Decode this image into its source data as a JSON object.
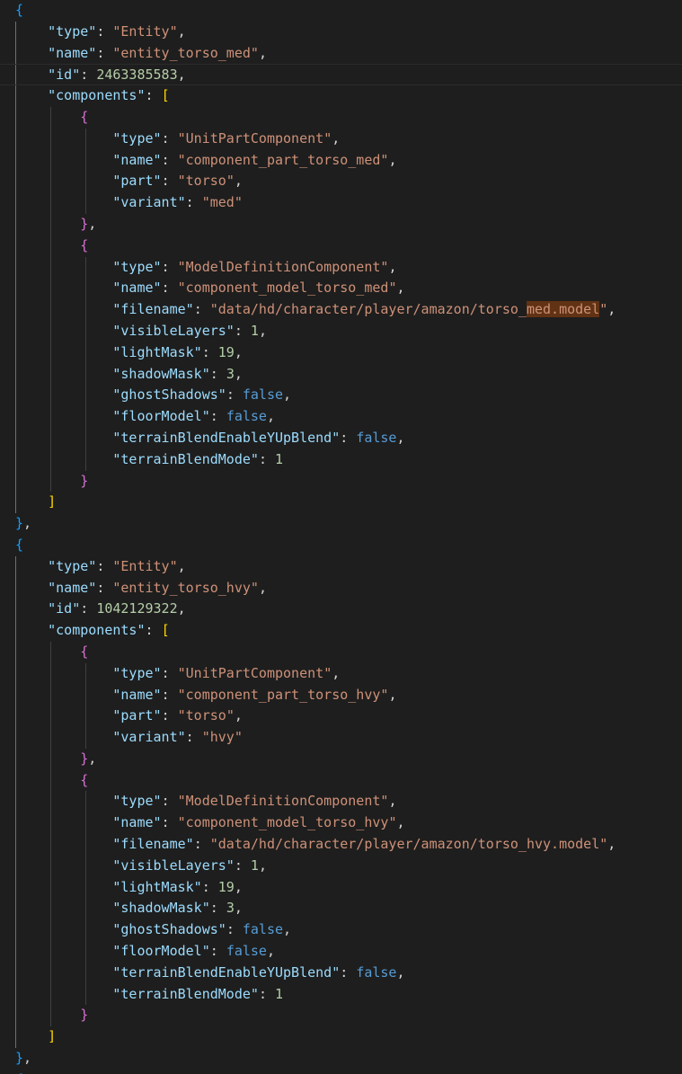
{
  "editor": {
    "entities": [
      {
        "type": "Entity",
        "name": "entity_torso_med",
        "id": "2463385583",
        "components": [
          {
            "type": "UnitPartComponent",
            "name": "component_part_torso_med",
            "part": "torso",
            "variant": "med"
          },
          {
            "type": "ModelDefinitionComponent",
            "name": "component_model_torso_med",
            "filename": "data/hd/character/player/amazon/torso_med.model",
            "visibleLayers": "1",
            "lightMask": "19",
            "shadowMask": "3",
            "ghostShadows": "false",
            "floorModel": "false",
            "terrainBlendEnableYUpBlend": "false",
            "terrainBlendMode": "1"
          }
        ]
      },
      {
        "type": "Entity",
        "name": "entity_torso_hvy",
        "id": "1042129322",
        "components": [
          {
            "type": "UnitPartComponent",
            "name": "component_part_torso_hvy",
            "part": "torso",
            "variant": "hvy"
          },
          {
            "type": "ModelDefinitionComponent",
            "name": "component_model_torso_hvy",
            "filename": "data/hd/character/player/amazon/torso_hvy.model",
            "visibleLayers": "1",
            "lightMask": "19",
            "shadowMask": "3",
            "ghostShadows": "false",
            "floorModel": "false",
            "terrainBlendEnableYUpBlend": "false",
            "terrainBlendMode": "1"
          }
        ]
      }
    ],
    "search_highlight": "med.model"
  },
  "colors": {
    "background": "#1e1e1e",
    "key": "#9cdcfe",
    "string": "#ce9178",
    "number": "#b5cea8",
    "boolean": "#569cd6",
    "bracket_level_1": "#179fff",
    "bracket_level_2": "#ffd700",
    "bracket_level_3": "#da70d6",
    "find_match": "#613214"
  }
}
